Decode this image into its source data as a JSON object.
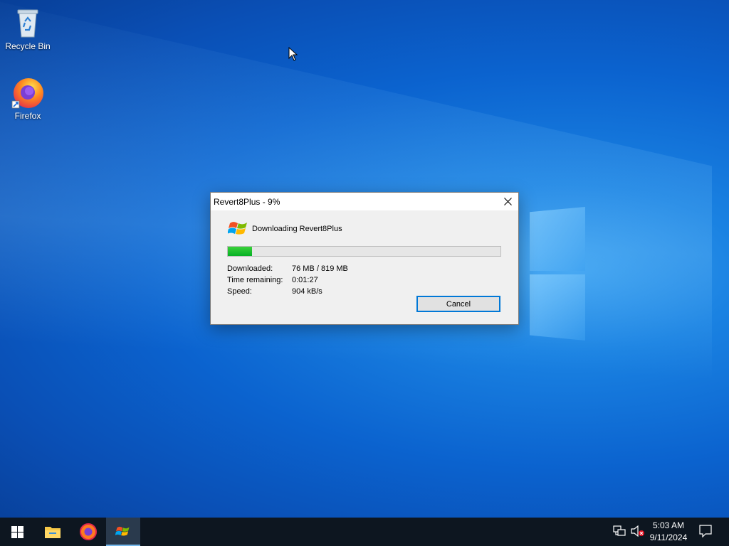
{
  "desktop": {
    "icons": [
      {
        "label": "Recycle Bin",
        "icon": "recycle-bin-icon"
      },
      {
        "label": "Firefox",
        "icon": "firefox-icon"
      }
    ]
  },
  "dialog": {
    "title": "Revert8Plus - 9%",
    "heading": "Downloading Revert8Plus",
    "progress_fraction": 0.09,
    "progress_color": "#06b025",
    "info": [
      {
        "label": "Downloaded:",
        "value": "76 MB / 819 MB"
      },
      {
        "label": "Time remaining:",
        "value": "0:01:27"
      },
      {
        "label": "Speed:",
        "value": "904 kB/s"
      }
    ],
    "cancel_label": "Cancel",
    "close_icon": "close-icon"
  },
  "taskbar": {
    "buttons": [
      {
        "name": "start",
        "icon": "windows-start-icon"
      },
      {
        "name": "file-explorer",
        "icon": "folder-icon"
      },
      {
        "name": "firefox",
        "icon": "firefox-icon"
      },
      {
        "name": "revert8plus",
        "icon": "windows-flag-icon",
        "active": true
      }
    ],
    "tray": {
      "network_icon": "network-icon",
      "volume_icon": "volume-muted-icon",
      "notification_icon": "action-center-icon"
    },
    "clock": {
      "time": "5:03 AM",
      "date": "9/11/2024"
    }
  },
  "colors": {
    "accent": "#0078d7",
    "taskbar": "#0d1620",
    "desktop": "#0b63cf"
  }
}
